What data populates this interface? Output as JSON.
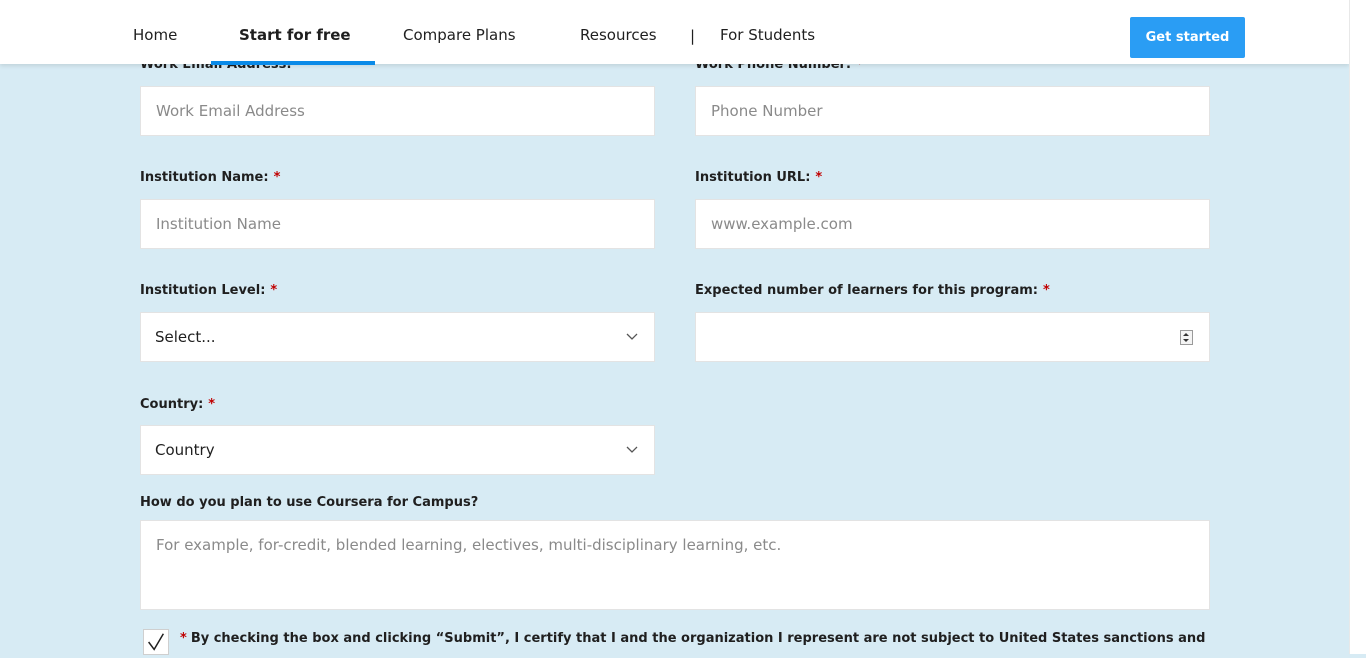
{
  "nav": {
    "items": [
      {
        "label": "Home"
      },
      {
        "label": "Start for free"
      },
      {
        "label": "Compare Plans"
      },
      {
        "label": "Resources"
      },
      {
        "label": "For Students"
      }
    ],
    "separator": "|",
    "cta_label": "Get started",
    "accent_color": "#2a9df4"
  },
  "form": {
    "required_marker": "*",
    "work_email": {
      "label": "Work Email Address:",
      "placeholder": "Work Email Address"
    },
    "work_phone": {
      "label": "Work Phone Number:",
      "placeholder": "Phone Number"
    },
    "institution_name": {
      "label": "Institution Name:",
      "placeholder": "Institution Name"
    },
    "institution_url": {
      "label": "Institution URL:",
      "placeholder": "www.example.com"
    },
    "institution_level": {
      "label": "Institution Level:",
      "value": "Select..."
    },
    "expected_learners": {
      "label": "Expected number of learners for this program:",
      "value": ""
    },
    "country": {
      "label": "Country:",
      "value": "Country"
    },
    "usage": {
      "label": "How do you plan to use Coursera for Campus?",
      "placeholder": "For example, for-credit, blended learning, electives, multi-disciplinary learning, etc."
    },
    "consent_text": "By checking the box and clicking “Submit”, I certify that I and the organization I represent are not subject to United States sanctions and"
  }
}
